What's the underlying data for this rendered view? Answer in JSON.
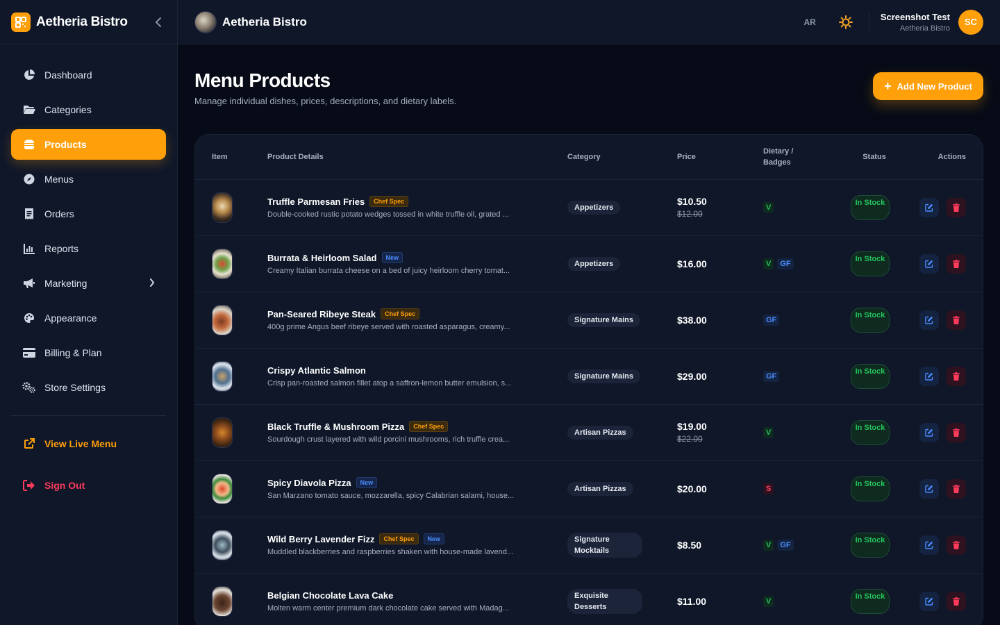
{
  "brand": {
    "name": "Aetheria Bistro"
  },
  "nav": {
    "items": [
      {
        "label": "Dashboard",
        "icon": "chart-pie-icon"
      },
      {
        "label": "Categories",
        "icon": "folder-icon"
      },
      {
        "label": "Products",
        "icon": "burger-icon",
        "active": true
      },
      {
        "label": "Menus",
        "icon": "compass-icon"
      },
      {
        "label": "Orders",
        "icon": "receipt-icon"
      },
      {
        "label": "Reports",
        "icon": "bar-chart-icon"
      },
      {
        "label": "Marketing",
        "icon": "megaphone-icon"
      },
      {
        "label": "Appearance",
        "icon": "palette-icon"
      },
      {
        "label": "Billing & Plan",
        "icon": "credit-card-icon"
      },
      {
        "label": "Store Settings",
        "icon": "gears-icon"
      }
    ],
    "view_live": "View Live Menu",
    "sign_out": "Sign Out"
  },
  "topbar": {
    "store_name": "Aetheria Bistro",
    "lang": "AR",
    "user_name": "Screenshot Test",
    "user_store": "Aetheria Bistro",
    "user_initials": "SC"
  },
  "page": {
    "title": "Menu Products",
    "subtitle": "Manage individual dishes, prices, descriptions, and dietary labels.",
    "add_button": "Add New Product"
  },
  "table": {
    "headers": {
      "item": "Item",
      "details": "Product Details",
      "category": "Category",
      "price": "Price",
      "dietary": "Dietary / Badges",
      "status": "Status",
      "actions": "Actions"
    },
    "rows": [
      {
        "name": "Truffle Parmesan Fries",
        "badges": [
          "Chef Spec"
        ],
        "desc": "Double-cooked rustic potato wedges tossed in white truffle oil, grated ...",
        "category": "Appetizers",
        "price": "$10.50",
        "old_price": "$12.00",
        "dietary": [
          "V"
        ],
        "status": "In Stock"
      },
      {
        "name": "Burrata & Heirloom Salad",
        "badges": [
          "New"
        ],
        "desc": "Creamy Italian burrata cheese on a bed of juicy heirloom cherry tomat...",
        "category": "Appetizers",
        "price": "$16.00",
        "old_price": "",
        "dietary": [
          "V",
          "GF"
        ],
        "status": "In Stock"
      },
      {
        "name": "Pan-Seared Ribeye Steak",
        "badges": [
          "Chef Spec"
        ],
        "desc": "400g prime Angus beef ribeye served with roasted asparagus, creamy...",
        "category": "Signature Mains",
        "price": "$38.00",
        "old_price": "",
        "dietary": [
          "GF"
        ],
        "status": "In Stock"
      },
      {
        "name": "Crispy Atlantic Salmon",
        "badges": [],
        "desc": "Crisp pan-roasted salmon fillet atop a saffron-lemon butter emulsion, s...",
        "category": "Signature Mains",
        "price": "$29.00",
        "old_price": "",
        "dietary": [
          "GF"
        ],
        "status": "In Stock"
      },
      {
        "name": "Black Truffle & Mushroom Pizza",
        "badges": [
          "Chef Spec"
        ],
        "desc": "Sourdough crust layered with wild porcini mushrooms, rich truffle crea...",
        "category": "Artisan Pizzas",
        "price": "$19.00",
        "old_price": "$22.00",
        "dietary": [
          "V"
        ],
        "status": "In Stock"
      },
      {
        "name": "Spicy Diavola Pizza",
        "badges": [
          "New"
        ],
        "desc": "San Marzano tomato sauce, mozzarella, spicy Calabrian salami, house...",
        "category": "Artisan Pizzas",
        "price": "$20.00",
        "old_price": "",
        "dietary": [
          "S"
        ],
        "status": "In Stock"
      },
      {
        "name": "Wild Berry Lavender Fizz",
        "badges": [
          "Chef Spec",
          "New"
        ],
        "desc": "Muddled blackberries and raspberries shaken with house-made lavend...",
        "category": "Signature Mocktails",
        "price": "$8.50",
        "old_price": "",
        "dietary": [
          "V",
          "GF"
        ],
        "status": "In Stock"
      },
      {
        "name": "Belgian Chocolate Lava Cake",
        "badges": [],
        "desc": "Molten warm center premium dark chocolate cake served with Madag...",
        "category": "Exquisite Desserts",
        "price": "$11.00",
        "old_price": "",
        "dietary": [
          "V"
        ],
        "status": "In Stock"
      }
    ]
  },
  "colors": {
    "accent": "#ff9f0a",
    "bg": "#060b17",
    "panel": "#0f1729",
    "success": "#22c55e",
    "info": "#4b8dff",
    "danger": "#ff3b5c"
  }
}
